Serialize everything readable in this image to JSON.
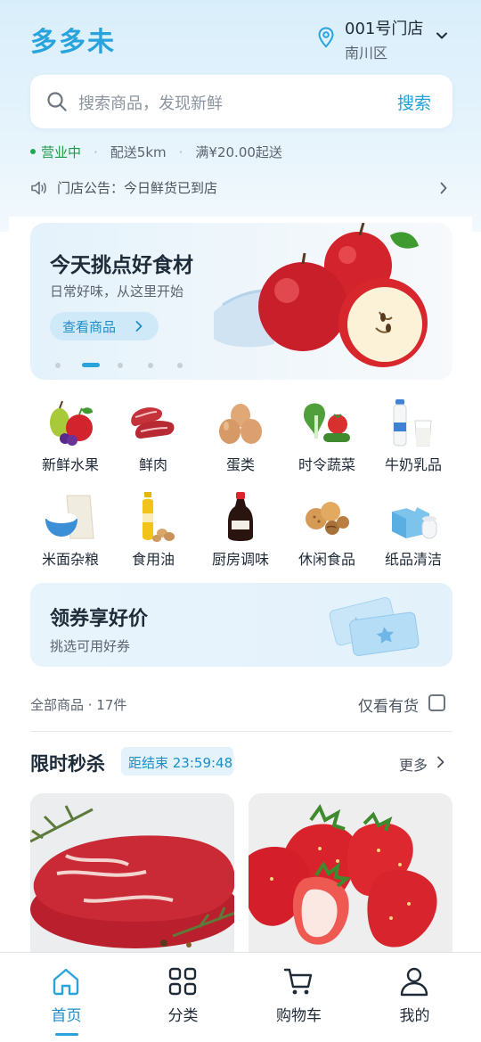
{
  "header": {
    "brand": "多多未",
    "store_name": "001号门店",
    "district": "南川区"
  },
  "search": {
    "placeholder": "搜索商品，发现新鲜",
    "button": "搜索"
  },
  "status": {
    "open": "营业中",
    "delivery": "配送5km",
    "min_order": "满¥20.00起送"
  },
  "notice": {
    "text": "门店公告：今日鲜货已到店"
  },
  "banner": {
    "title": "今天挑点好食材",
    "subtitle": "日常好味，从这里开始",
    "button": "查看商品",
    "active_slide": 2,
    "slide_count": 5
  },
  "categories": [
    {
      "label": "新鲜水果",
      "icon": "fruit-icon"
    },
    {
      "label": "鲜肉",
      "icon": "meat-icon"
    },
    {
      "label": "蛋类",
      "icon": "eggs-icon"
    },
    {
      "label": "时令蔬菜",
      "icon": "vegetables-icon"
    },
    {
      "label": "牛奶乳品",
      "icon": "milk-icon"
    },
    {
      "label": "米面杂粮",
      "icon": "rice-icon"
    },
    {
      "label": "食用油",
      "icon": "oil-icon"
    },
    {
      "label": "厨房调味",
      "icon": "soy-sauce-icon"
    },
    {
      "label": "休闲食品",
      "icon": "snacks-icon"
    },
    {
      "label": "纸品清洁",
      "icon": "tissue-icon"
    }
  ],
  "coupon": {
    "title": "领券享好价",
    "subtitle": "挑选可用好券"
  },
  "filter": {
    "all_products": "全部商品 · 17件",
    "in_stock_only": "仅看有货",
    "in_stock_checked": false
  },
  "flash_sale": {
    "title": "限时秒杀",
    "countdown": "距结束 23:59:48",
    "more": "更多"
  },
  "tabbar": [
    {
      "label": "首页",
      "icon": "home-icon",
      "active": true
    },
    {
      "label": "分类",
      "icon": "grid-icon",
      "active": false
    },
    {
      "label": "购物车",
      "icon": "cart-icon",
      "active": false
    },
    {
      "label": "我的",
      "icon": "user-icon",
      "active": false
    }
  ],
  "colors": {
    "accent": "#29a3dc",
    "open_green": "#1f9a49"
  }
}
